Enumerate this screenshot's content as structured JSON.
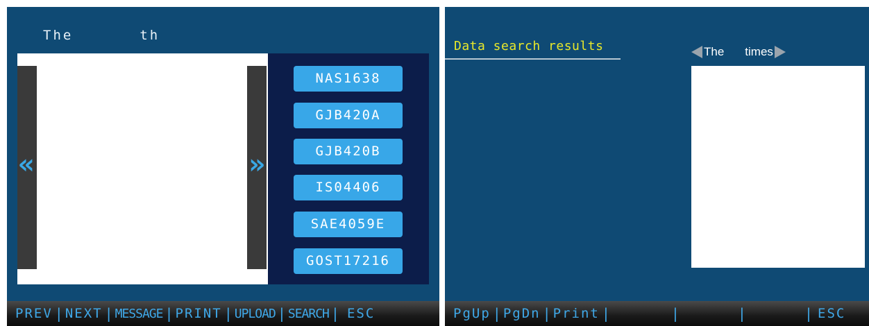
{
  "left_screen": {
    "title_part1": "The",
    "title_part2": "th",
    "prev_arrow": "«",
    "next_arrow": "»",
    "standards": [
      "NAS1638",
      "GJB420A",
      "GJB420B",
      "IS04406",
      "SAE4059E",
      "GOST17216"
    ],
    "function_keys": [
      "PREV",
      "NEXT",
      "MESSAGE",
      "PRINT",
      "UPLOAD",
      "SEARCH",
      "ESC"
    ]
  },
  "right_screen": {
    "results_title": "Data search results",
    "times_label_part1": "The",
    "times_label_part2": "times",
    "function_keys": [
      "PgUp",
      "PgDn",
      "Print",
      "",
      "",
      "",
      "ESC"
    ]
  },
  "colors": {
    "screen_bg": "#0f4a74",
    "button_blue": "#38a7e8",
    "standards_panel": "#0c1d4a",
    "results_title": "#e8e82a"
  },
  "icons": {
    "prev": "double-chevron-left-icon",
    "next": "double-chevron-right-icon",
    "times_prev": "triangle-left-icon",
    "times_next": "triangle-right-icon"
  }
}
